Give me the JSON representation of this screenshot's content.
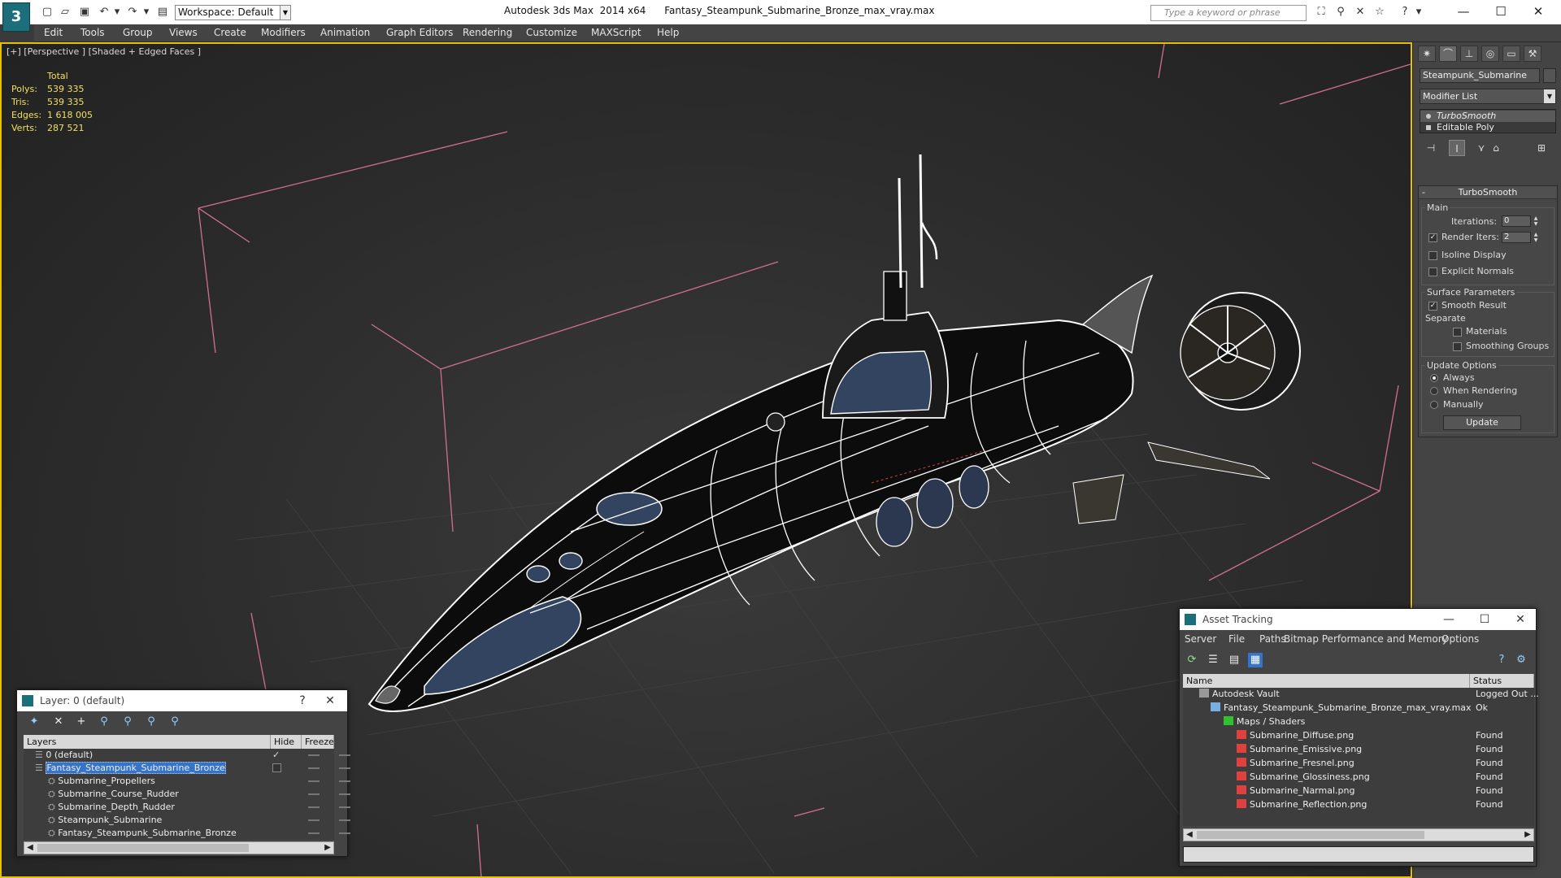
{
  "app": {
    "logo_text": "3",
    "workspace": "Workspace: Default",
    "title": "Autodesk 3ds Max  2014 x64      Fantasy_Steampunk_Submarine_Bronze_max_vray.max",
    "search_placeholder": "Type a keyword or phrase"
  },
  "menu": [
    "Edit",
    "Tools",
    "Group",
    "Views",
    "Create",
    "Modifiers",
    "Animation",
    "Graph Editors",
    "Rendering",
    "Customize",
    "MAXScript",
    "Help"
  ],
  "viewport": {
    "label": "[+] [Perspective ] [Shaded + Edged Faces ]",
    "stats": {
      "header": "Total",
      "rows": [
        {
          "k": "Polys:",
          "v": "539 335"
        },
        {
          "k": "Tris:",
          "v": "539 335"
        },
        {
          "k": "Edges:",
          "v": "1 618 005"
        },
        {
          "k": "Verts:",
          "v": "287 521"
        }
      ]
    },
    "bbox_color": "#d0708f",
    "wire_color": "#ffffff",
    "border_color": "#e5c100"
  },
  "command_panel": {
    "object_name": "Steampunk_Submarine",
    "modifier_list": "Modifier List",
    "stack": [
      "TurboSmooth",
      "Editable Poly"
    ],
    "rollout": {
      "title": "TurboSmooth",
      "main_label": "Main",
      "iterations_label": "Iterations:",
      "iterations_value": "0",
      "render_iters_label": "Render Iters:",
      "render_iters_value": "2",
      "isoline_label": "Isoline Display",
      "explicit_normals_label": "Explicit Normals",
      "surface_label": "Surface Parameters",
      "smooth_result_label": "Smooth Result",
      "separate_label": "Separate",
      "materials_label": "Materials",
      "smoothing_groups_label": "Smoothing Groups",
      "update_options_label": "Update Options",
      "always_label": "Always",
      "when_rendering_label": "When Rendering",
      "manually_label": "Manually",
      "update_button": "Update"
    }
  },
  "layers": {
    "title": "Layer: 0 (default)",
    "col_layers": "Layers",
    "col_hide": "Hide",
    "col_freeze": "Freeze",
    "items": [
      {
        "name": "0 (default)",
        "indent": 0
      },
      {
        "name": "Fantasy_Steampunk_Submarine_Bronze",
        "indent": 0
      },
      {
        "name": "Submarine_Propellers",
        "indent": 1
      },
      {
        "name": "Submarine_Course_Rudder",
        "indent": 1
      },
      {
        "name": "Submarine_Depth_Rudder",
        "indent": 1
      },
      {
        "name": "Steampunk_Submarine",
        "indent": 1
      },
      {
        "name": "Fantasy_Steampunk_Submarine_Bronze",
        "indent": 1
      }
    ]
  },
  "asset_tracking": {
    "title": "Asset Tracking",
    "menu": [
      "Server",
      "File",
      "Paths",
      "Bitmap Performance and Memory",
      "Options"
    ],
    "col_name": "Name",
    "col_status": "Status",
    "rows": [
      {
        "name": "Autodesk Vault",
        "status": "Logged Out ...",
        "indent": 0
      },
      {
        "name": "Fantasy_Steampunk_Submarine_Bronze_max_vray.max",
        "status": "Ok",
        "indent": 1
      },
      {
        "name": "Maps / Shaders",
        "status": "",
        "indent": 2
      },
      {
        "name": "Submarine_Diffuse.png",
        "status": "Found",
        "indent": 3
      },
      {
        "name": "Submarine_Emissive.png",
        "status": "Found",
        "indent": 3
      },
      {
        "name": "Submarine_Fresnel.png",
        "status": "Found",
        "indent": 3
      },
      {
        "name": "Submarine_Glossiness.png",
        "status": "Found",
        "indent": 3
      },
      {
        "name": "Submarine_Narmal.png",
        "status": "Found",
        "indent": 3
      },
      {
        "name": "Submarine_Reflection.png",
        "status": "Found",
        "indent": 3
      }
    ]
  }
}
